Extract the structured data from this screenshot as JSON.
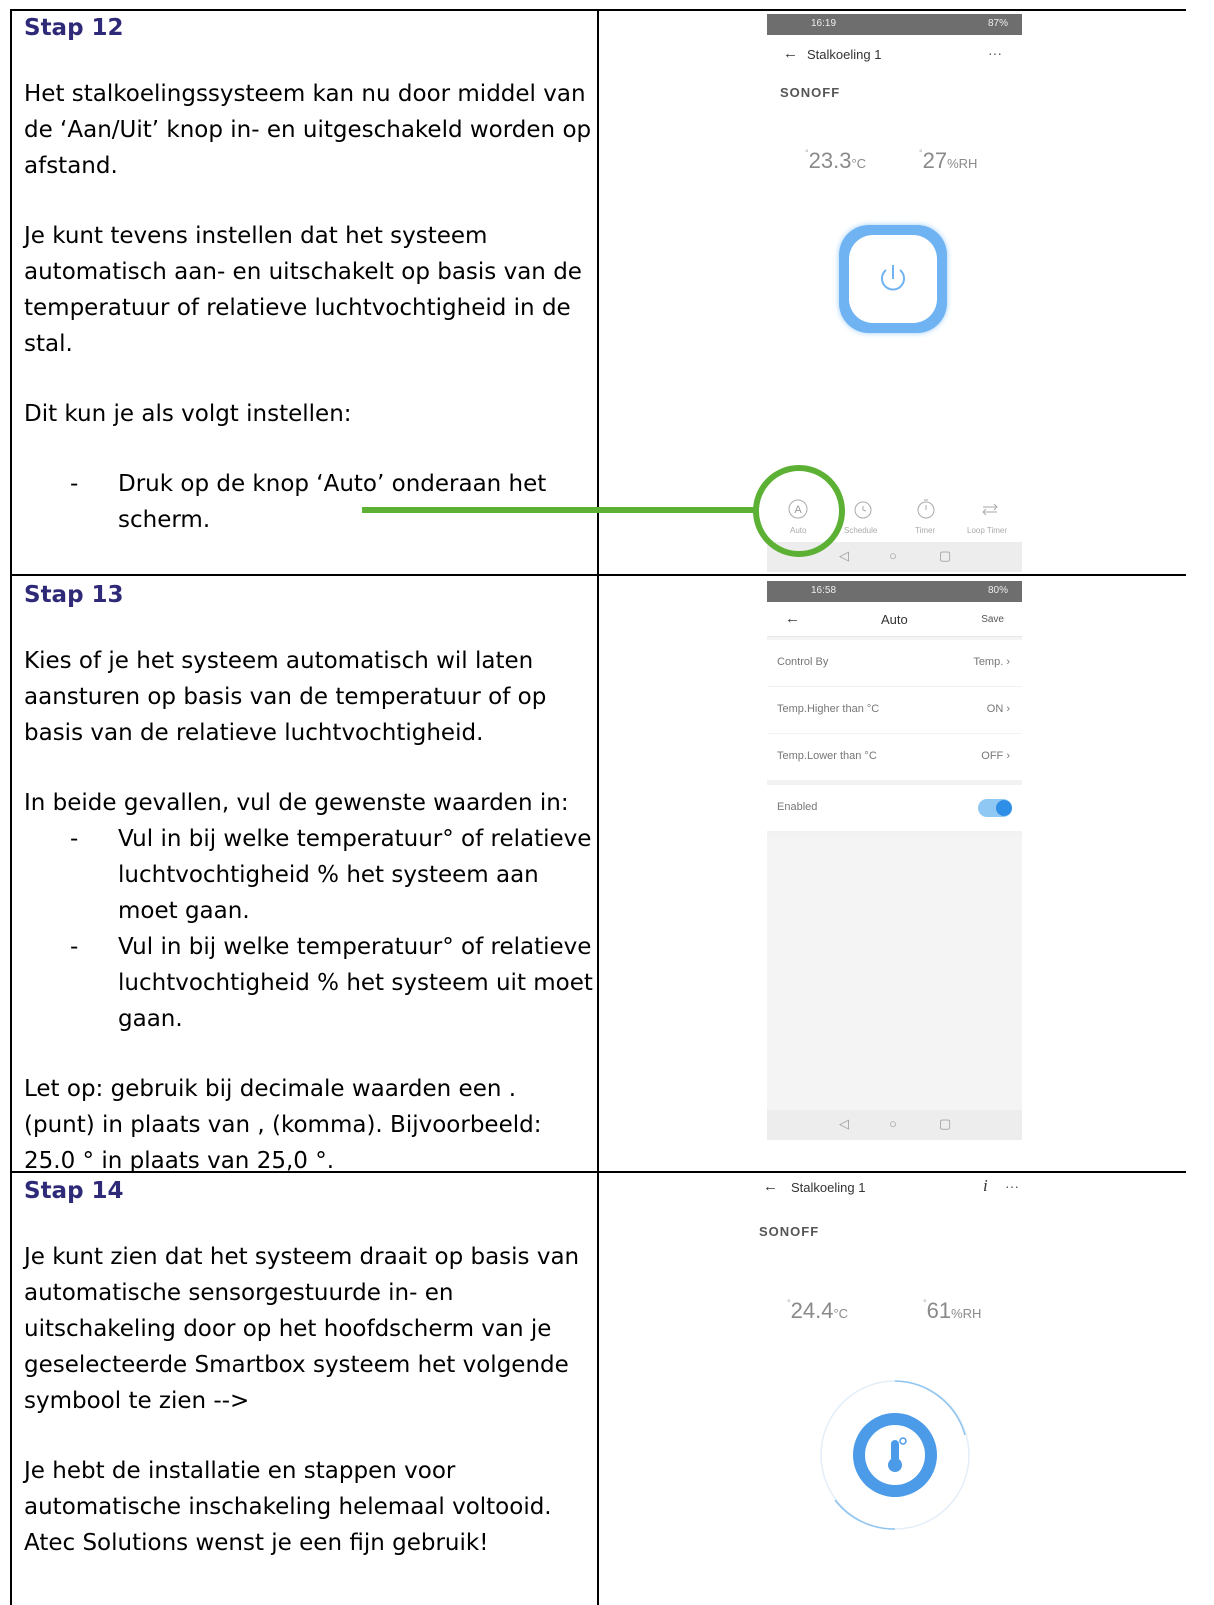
{
  "steps": [
    {
      "title": "Stap 12",
      "p1": "Het stalkoelingssysteem kan nu door middel van de ‘Aan/Uit’ knop in- en uitgeschakeld worden op afstand.",
      "p2": "Je kunt tevens instellen dat het systeem automatisch aan- en uitschakelt op basis van de temperatuur of relatieve luchtvochtigheid in de stal.",
      "p3": "Dit kun je als volgt instellen:",
      "bullets": [
        "Druk op de knop ‘Auto’ onderaan het scherm."
      ]
    },
    {
      "title": "Stap 13",
      "p1": "Kies of je het systeem automatisch wil laten aansturen op basis van de temperatuur of op basis van de relatieve luchtvochtigheid.",
      "p2": "In beide gevallen, vul de gewenste waarden in:",
      "bullets": [
        "Vul in bij welke temperatuur° of relatieve luchtvochtigheid % het systeem aan moet gaan.",
        "Vul in bij welke temperatuur° of relatieve luchtvochtigheid % het systeem uit moet gaan."
      ],
      "p3": "Let op: gebruik bij decimale waarden een . (punt) in plaats van , (komma). Bijvoorbeeld: 25.0 ° in plaats van 25,0 °."
    },
    {
      "title": "Stap 14",
      "p1": "Je kunt zien dat het systeem draait op basis van automatische sensorgestuurde in- en uitschakeling door op het hoofdscherm van je geselecteerde Smartbox systeem het volgende symbool te zien  -->",
      "p2": "Je hebt de installatie en stappen voor automatische inschakeling helemaal voltooid. Atec Solutions wenst je een fijn gebruik!"
    }
  ],
  "screen1": {
    "status_time": "16:19",
    "status_right": "87%",
    "title": "Stalkoeling 1",
    "menu": "···",
    "brand": "SONOFF",
    "temperature": "23.3",
    "temp_unit": "°C",
    "humidity": "27",
    "hum_unit": "%RH",
    "tabs": [
      "Auto",
      "Schedule",
      "Timer",
      "Loop Timer"
    ]
  },
  "screen2": {
    "status_time": "16:58",
    "status_right": "80%",
    "title": "Auto",
    "save": "Save",
    "rows": [
      {
        "label": "Control By",
        "value": "Temp. ›"
      },
      {
        "label": "Temp.Higher than  °C",
        "value": "ON ›"
      },
      {
        "label": "Temp.Lower than  °C",
        "value": "OFF ›"
      }
    ],
    "enabled_label": "Enabled"
  },
  "screen3": {
    "title": "Stalkoeling 1",
    "info": "i",
    "menu": "···",
    "brand": "SONOFF",
    "temperature": "24.4",
    "temp_unit": "°C",
    "humidity": "61",
    "hum_unit": "%RH"
  },
  "colors": {
    "heading": "#2e2a78",
    "highlight": "#5cb135",
    "accent_blue": "#2f8fe6"
  }
}
